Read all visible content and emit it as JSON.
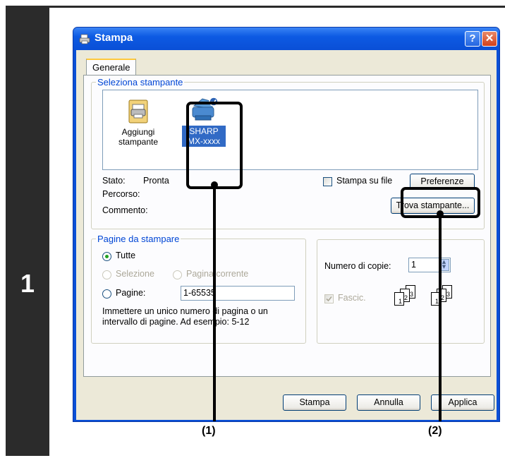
{
  "step": {
    "number": "1"
  },
  "dialog": {
    "title": "Stampa",
    "help_label": "?",
    "close_label": "✕",
    "tab": "Generale",
    "select_printer": {
      "legend": "Seleziona stampante",
      "printers": [
        {
          "line1": "Aggiungi",
          "line2": "stampante",
          "icon": "add-printer-icon"
        },
        {
          "line1": "SHARP",
          "line2": "MX-xxxx",
          "icon": "printer-icon",
          "selected": true
        }
      ],
      "status_label": "Stato:",
      "status_value": "Pronta",
      "path_label": "Percorso:",
      "comment_label": "Commento:",
      "print_to_file": "Stampa su file",
      "preferences_button": "Preferenze",
      "find_printer_button": "Trova stampante..."
    },
    "page_range": {
      "legend": "Pagine da stampare",
      "all": "Tutte",
      "selection": "Selezione",
      "current_page": "Pagina corrente",
      "pages": "Pagine:",
      "pages_value": "1-65535",
      "hint_line1": "Immettere un unico numero di pagina o un",
      "hint_line2": "intervallo di pagine. Ad esempio: 5-12"
    },
    "copies": {
      "label": "Numero di copie:",
      "value": "1",
      "collate": "Fascic."
    },
    "buttons": {
      "print": "Stampa",
      "cancel": "Annulla",
      "apply": "Applica"
    }
  },
  "callouts": {
    "one": "(1)",
    "two": "(2)"
  },
  "colors": {
    "titlebar": "#0a4fd6",
    "dialog_bg": "#ece9d8",
    "legend": "#0046d5",
    "selection": "#316ac5"
  }
}
